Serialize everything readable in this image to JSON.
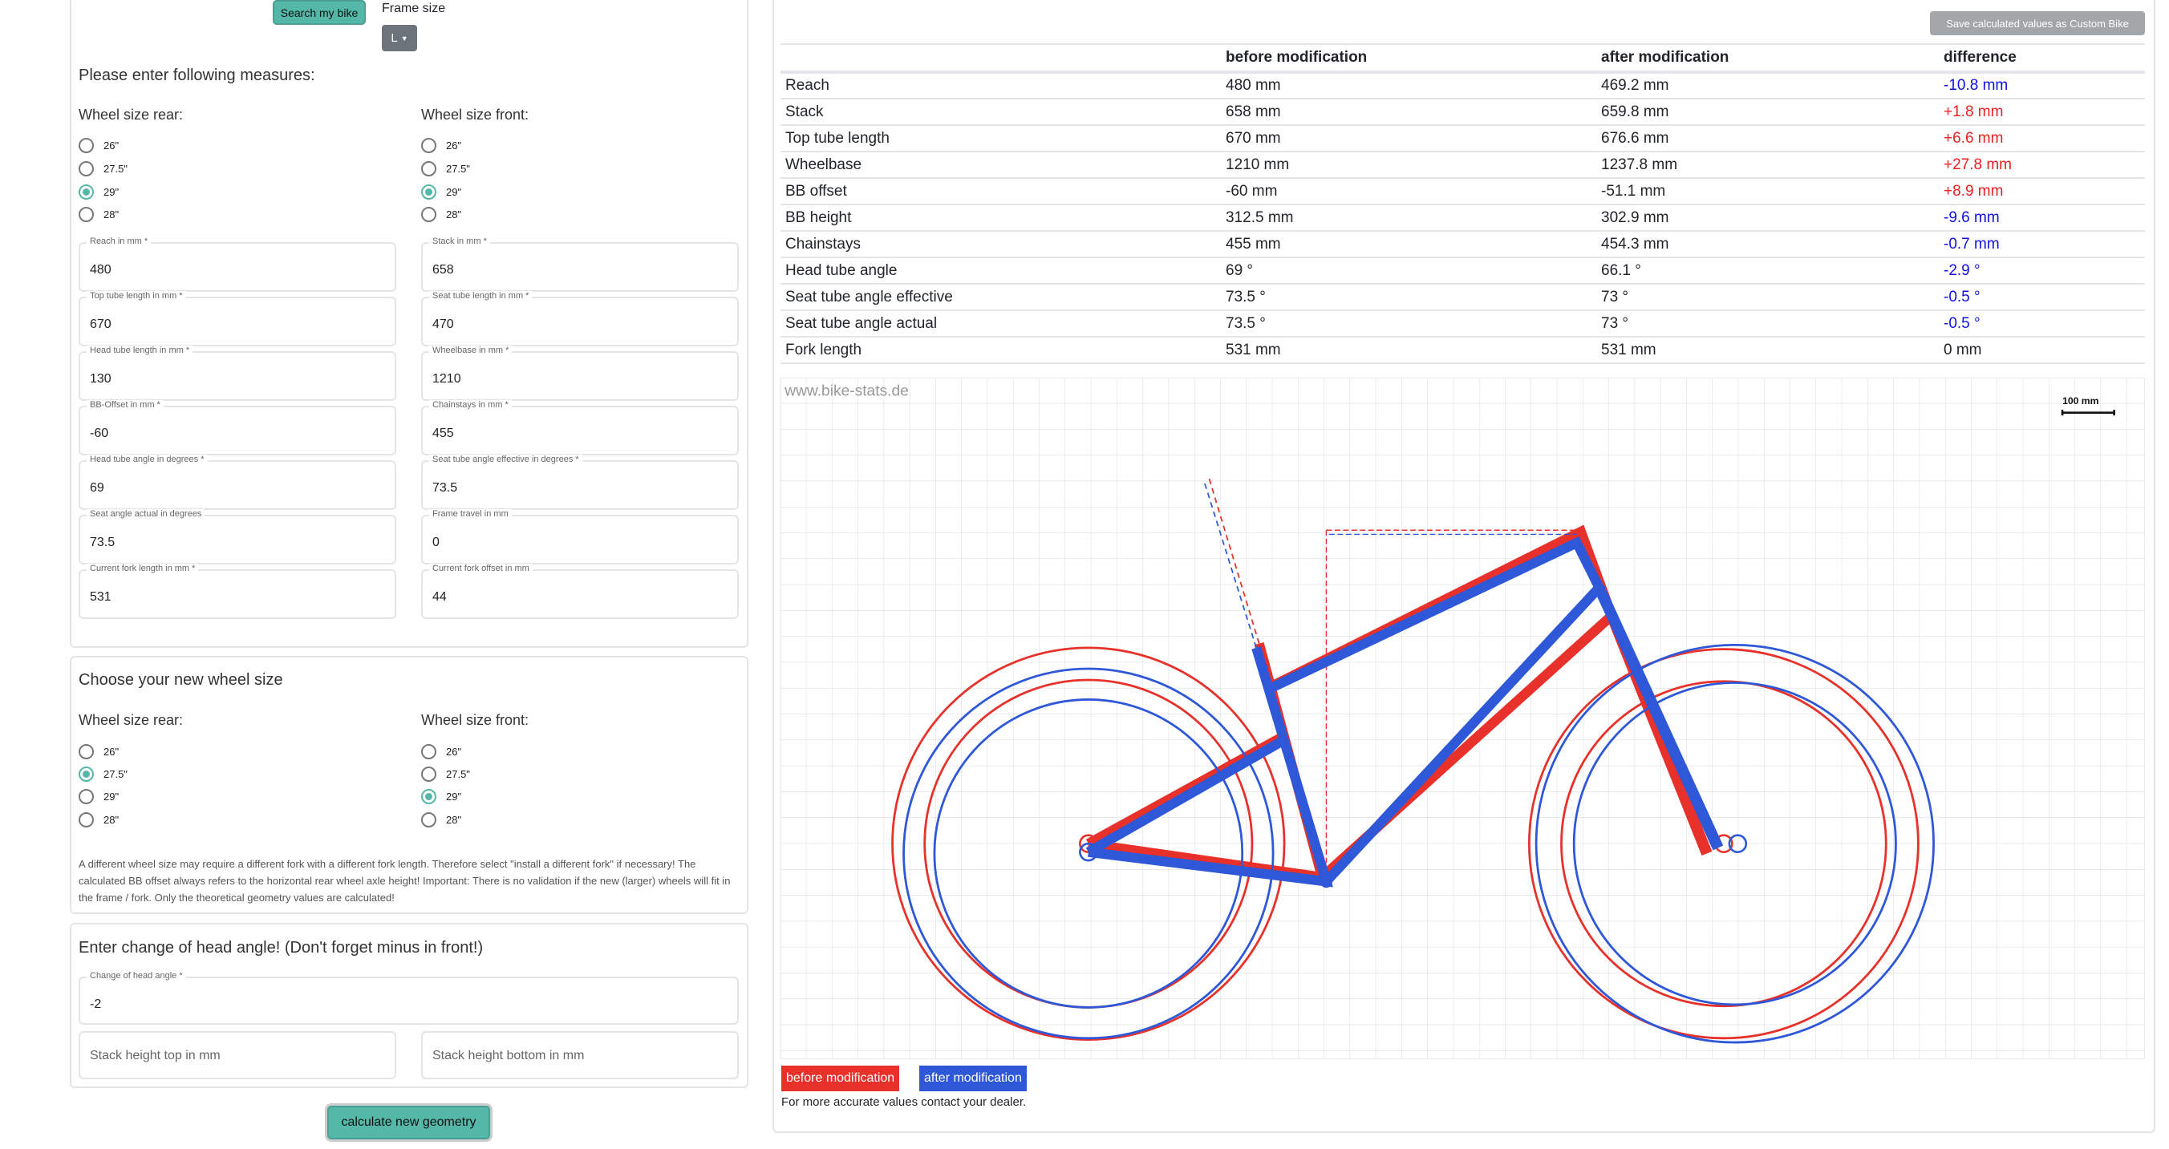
{
  "header": {
    "search_button": "Search my bike",
    "frame_size_label": "Frame size",
    "frame_size_value": "L"
  },
  "measures": {
    "title": "Please enter following measures:",
    "rear_label": "Wheel size rear:",
    "front_label": "Wheel size front:",
    "wheel_options": [
      "26\"",
      "27.5\"",
      "29\"",
      "28\""
    ],
    "rear_selected": "29\"",
    "front_selected": "29\"",
    "fields": [
      {
        "label": "Reach in mm *",
        "value": "480"
      },
      {
        "label": "Stack in mm *",
        "value": "658"
      },
      {
        "label": "Top tube length in mm *",
        "value": "670"
      },
      {
        "label": "Seat tube length in mm *",
        "value": "470"
      },
      {
        "label": "Head tube length in mm *",
        "value": "130"
      },
      {
        "label": "Wheelbase in mm *",
        "value": "1210"
      },
      {
        "label": "BB-Offset in mm *",
        "value": "-60"
      },
      {
        "label": "Chainstays in mm *",
        "value": "455"
      },
      {
        "label": "Head tube angle in degrees *",
        "value": "69"
      },
      {
        "label": "Seat tube angle effective in degrees *",
        "value": "73.5"
      },
      {
        "label": "Seat angle actual in degrees",
        "value": "73.5"
      },
      {
        "label": "Frame travel in mm",
        "value": "0"
      },
      {
        "label": "Current fork length in mm *",
        "value": "531"
      },
      {
        "label": "Current fork offset in mm",
        "value": "44"
      }
    ]
  },
  "new_wheel": {
    "title": "Choose your new wheel size",
    "rear_label": "Wheel size rear:",
    "front_label": "Wheel size front:",
    "rear_selected": "27.5\"",
    "front_selected": "29\"",
    "note": "A different wheel size may require a different fork with a different fork length. Therefore select \"install a different fork\" if necessary! The calculated BB offset always refers to the horizontal rear wheel axle height! Important: There is no validation if the new (larger) wheels will fit in the frame / fork. Only the theoretical geometry values are calculated!"
  },
  "head_angle": {
    "title": "Enter change of head angle! (Don't forget minus in front!)",
    "change_label": "Change of head angle *",
    "change_value": "-2",
    "stack_top_placeholder": "Stack height top in mm",
    "stack_bottom_placeholder": "Stack height bottom in mm"
  },
  "calculate_button": "calculate new geometry",
  "results": {
    "save_button": "Save calculated values as Custom Bike",
    "columns": [
      "",
      "before modification",
      "after modification",
      "difference"
    ],
    "rows": [
      {
        "name": "Reach",
        "before": "480 mm",
        "after": "469.2 mm",
        "diff": "-10.8 mm"
      },
      {
        "name": "Stack",
        "before": "658 mm",
        "after": "659.8 mm",
        "diff": "+1.8 mm"
      },
      {
        "name": "Top tube length",
        "before": "670 mm",
        "after": "676.6 mm",
        "diff": "+6.6 mm"
      },
      {
        "name": "Wheelbase",
        "before": "1210 mm",
        "after": "1237.8 mm",
        "diff": "+27.8 mm"
      },
      {
        "name": "BB offset",
        "before": "-60 mm",
        "after": "-51.1 mm",
        "diff": "+8.9 mm"
      },
      {
        "name": "BB height",
        "before": "312.5 mm",
        "after": "302.9 mm",
        "diff": "-9.6 mm"
      },
      {
        "name": "Chainstays",
        "before": "455 mm",
        "after": "454.3 mm",
        "diff": "-0.7 mm"
      },
      {
        "name": "Head tube angle",
        "before": "69 °",
        "after": "66.1 °",
        "diff": "-2.9 °"
      },
      {
        "name": "Seat tube angle effective",
        "before": "73.5 °",
        "after": "73 °",
        "diff": "-0.5 °"
      },
      {
        "name": "Seat tube angle actual",
        "before": "73.5 °",
        "after": "73 °",
        "diff": "-0.5 °"
      },
      {
        "name": "Fork length",
        "before": "531 mm",
        "after": "531 mm",
        "diff": "0 mm"
      }
    ],
    "colors": {
      "positive": "#e82020",
      "negative": "#1010e0"
    }
  },
  "drawing": {
    "watermark": "www.bike-stats.de",
    "scale_label": "100 mm",
    "legend_before": "before modification",
    "legend_after": "after modification",
    "colors": {
      "before": "#e8312a",
      "after": "#2e58d8"
    },
    "footer": "For more accurate values contact your dealer."
  }
}
